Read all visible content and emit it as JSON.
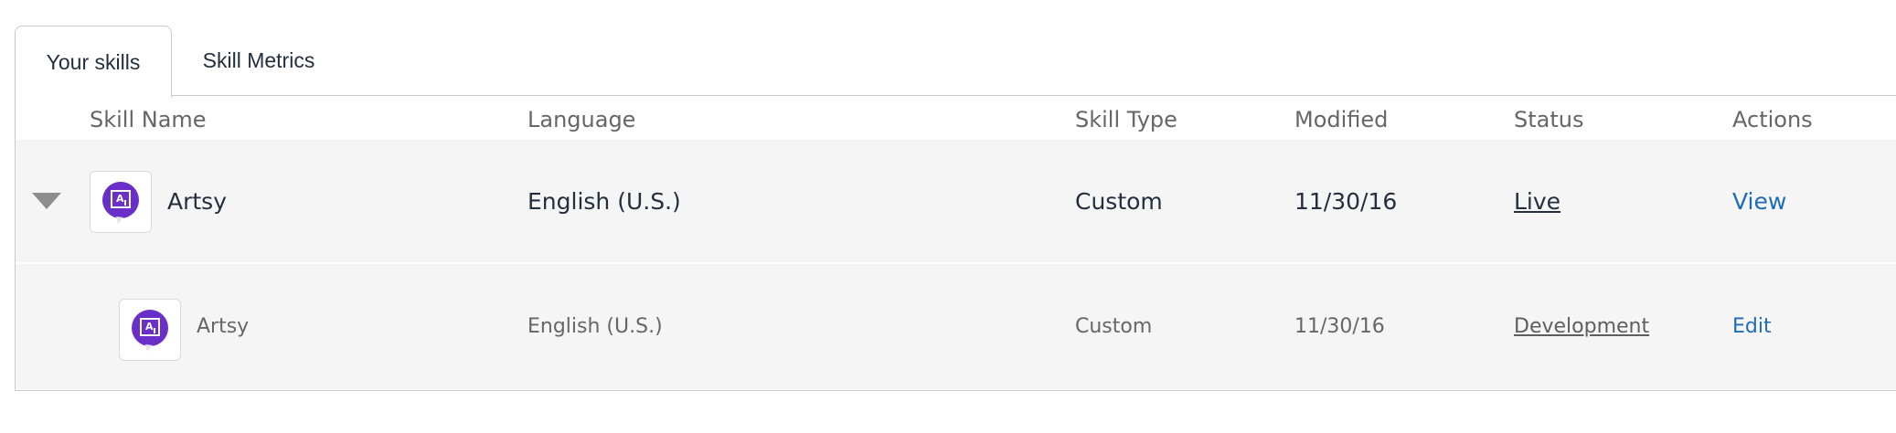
{
  "tabs": [
    {
      "label": "Your skills",
      "active": true
    },
    {
      "label": "Skill Metrics",
      "active": false
    }
  ],
  "table": {
    "columns": [
      "Skill Name",
      "Language",
      "Skill Type",
      "Modified",
      "Status",
      "Actions"
    ],
    "rows": [
      {
        "name": "Artsy",
        "language": "English (U.S.)",
        "type": "Custom",
        "modified": "11/30/16",
        "status": "Live",
        "action": "View",
        "expanded": true,
        "icon": "skill-icon"
      },
      {
        "name": "Artsy",
        "language": "English (U.S.)",
        "type": "Custom",
        "modified": "11/30/16",
        "status": "Development",
        "action": "Edit",
        "icon": "skill-icon"
      }
    ]
  },
  "colors": {
    "accent_link": "#1f6bb5",
    "icon_purple": "#6a2fc8",
    "row_background": "#f5f5f5"
  }
}
